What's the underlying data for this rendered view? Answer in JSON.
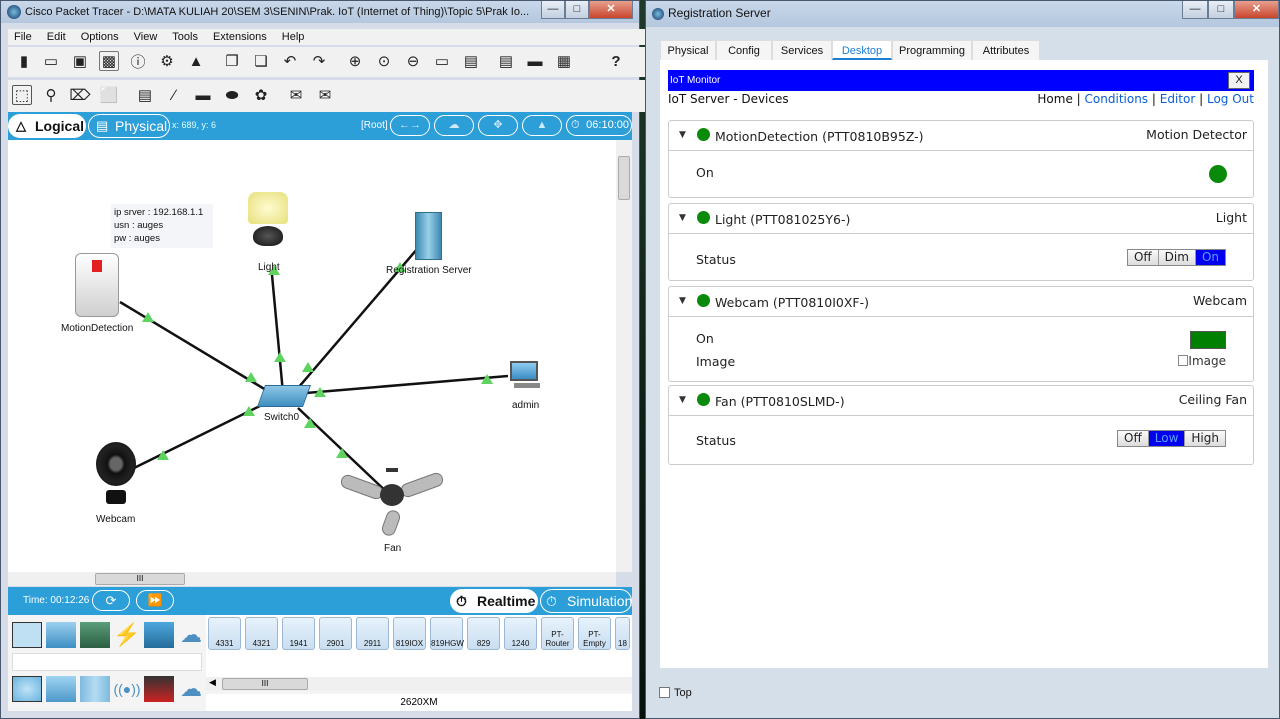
{
  "left_window": {
    "title": "Cisco Packet Tracer - D:\\MATA KULIAH 20\\SEM 3\\SENIN\\Prak. IoT (Internet of Thing)\\Topic 5\\Prak Io...",
    "menu": [
      "File",
      "Edit",
      "Options",
      "View",
      "Tools",
      "Extensions",
      "Help"
    ],
    "help_glyph": "?",
    "logical_label": "Logical",
    "physical_label": "Physical",
    "coords": "x: 689, y: 6",
    "root_label": "[Root]",
    "clock": "06:10:00",
    "note": [
      "ip srver : 192.168.1.1",
      "usn : auges",
      "pw : auges"
    ],
    "nodes": {
      "light": "Light",
      "server": "Registration Server",
      "motion": "MotionDetection",
      "switch": "Switch0",
      "admin": "admin",
      "webcam": "Webcam",
      "fan": "Fan"
    },
    "time_label": "Time: 00:12:26",
    "realtime_label": "Realtime",
    "simulation_label": "Simulation",
    "models": [
      "4331",
      "4321",
      "1941",
      "2901",
      "2911",
      "819IOX",
      "819HGW",
      "829",
      "1240",
      "PT-Router",
      "PT-Empty",
      "18"
    ],
    "selected_model": "2620XM",
    "hscroll_glyph": "III"
  },
  "right_window": {
    "title": "Registration Server",
    "tabs": [
      "Physical",
      "Config",
      "Services",
      "Desktop",
      "Programming",
      "Attributes"
    ],
    "active_tab": "Desktop",
    "iot_monitor": "IoT Monitor",
    "close_glyph": "X",
    "header": "IoT Server - Devices",
    "nav": {
      "home": "Home",
      "conditions": "Conditions",
      "editor": "Editor",
      "logout": "Log Out",
      "sep": "|"
    },
    "devices": [
      {
        "name": "MotionDetection (PTT0810B95Z-)",
        "type": "Motion Detector",
        "rows": [
          {
            "label": "On"
          }
        ]
      },
      {
        "name": "Light (PTT081025Y6-)",
        "type": "Light",
        "rows": [
          {
            "label": "Status",
            "options": [
              "Off",
              "Dim",
              "On"
            ],
            "selected": "On"
          }
        ]
      },
      {
        "name": "Webcam (PTT0810I0XF-)",
        "type": "Webcam",
        "rows": [
          {
            "label": "On"
          },
          {
            "label": "Image",
            "alt": "Image"
          }
        ]
      },
      {
        "name": "Fan (PTT0810SLMD-)",
        "type": "Ceiling Fan",
        "rows": [
          {
            "label": "Status",
            "options": [
              "Off",
              "Low",
              "High"
            ],
            "selected": "Low"
          }
        ]
      }
    ],
    "top_checkbox": "Top",
    "colors": {
      "status_green": "#0a8a0a",
      "selected_blue": "#0000ee",
      "iot_bar": "#0000ff"
    }
  }
}
